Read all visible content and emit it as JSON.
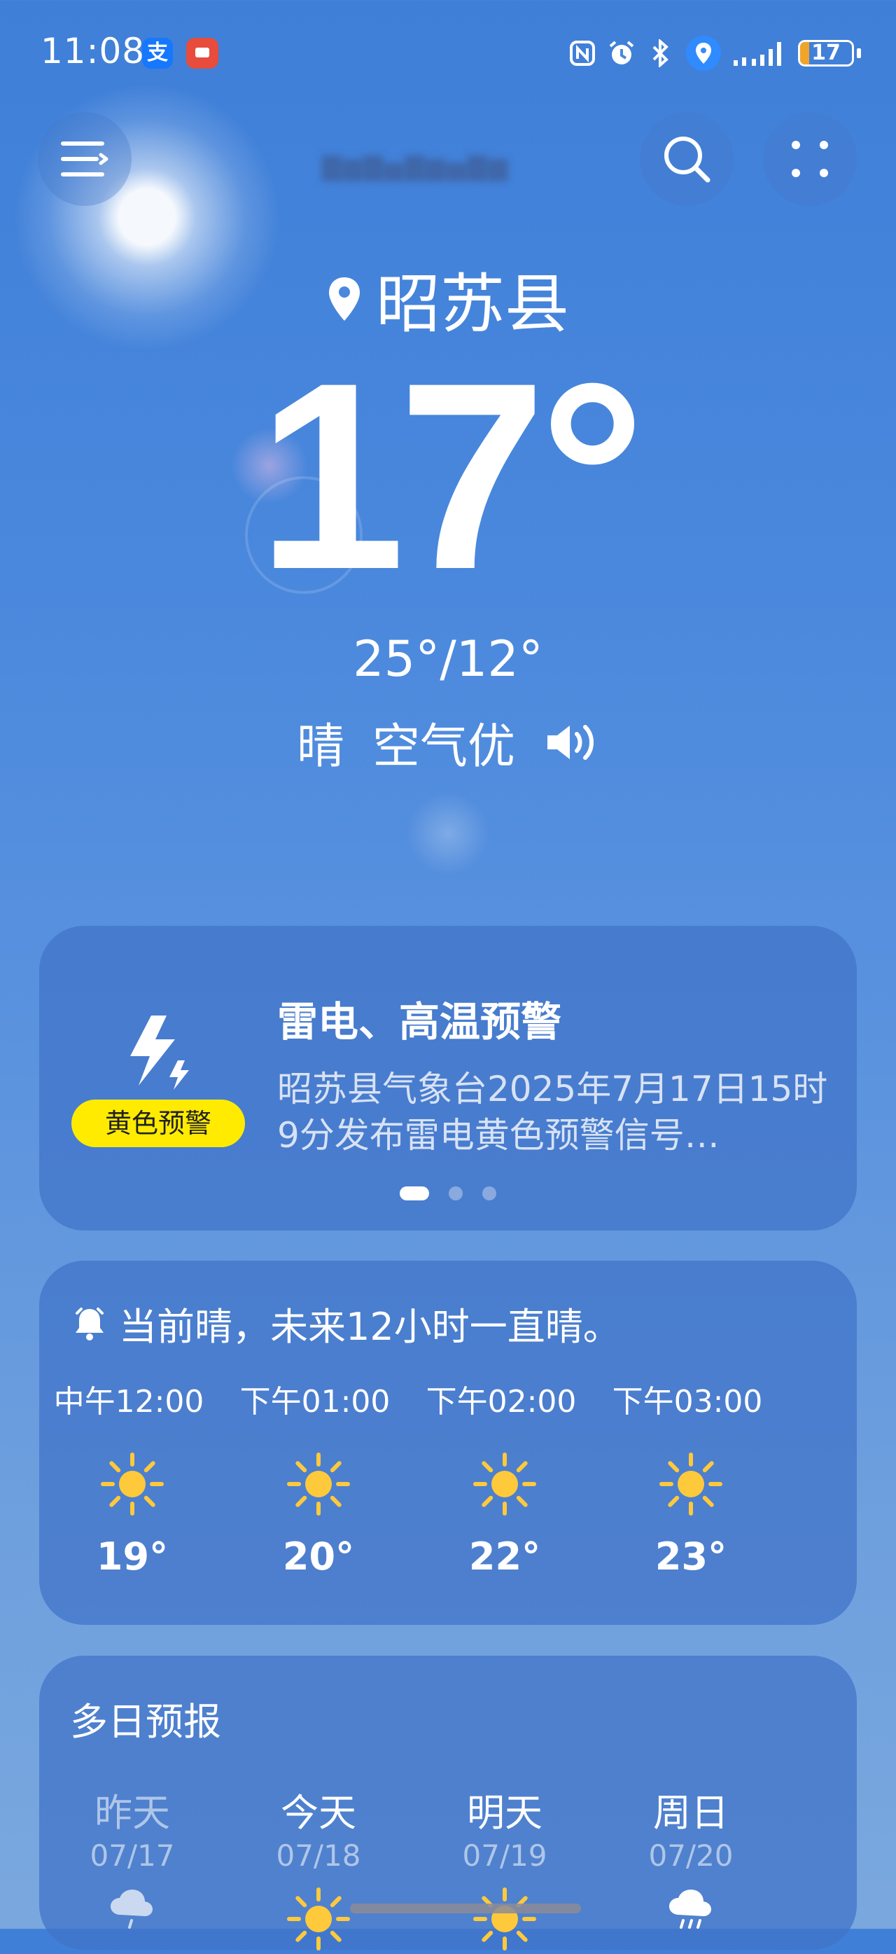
{
  "status_bar": {
    "time": "11:08",
    "alipay_glyph": "支",
    "battery": "17",
    "battery_level": 0.17,
    "icons": [
      "alipay-icon",
      "screen-recorder-icon",
      "nfc-icon",
      "alarm-icon",
      "bluetooth-icon",
      "location-icon",
      "signal-icon",
      "battery-icon"
    ]
  },
  "header": {
    "menu_icon": "menu-icon",
    "search_icon": "search-icon",
    "more_icon": "grid-dots-icon"
  },
  "location": {
    "name": "昭苏县",
    "icon": "location-pin-icon"
  },
  "current": {
    "temperature": "17°",
    "range": "25°/12°",
    "condition": "晴",
    "air_quality": "空气优",
    "speaker_icon": "speaker-icon"
  },
  "warning": {
    "title": "雷电、高温预警",
    "badge": "黄色预警",
    "body": "昭苏县气象台2025年7月17日15时9分发布雷电黄色预警信号…",
    "icon": "lightning-icon",
    "badge_color": "#ffeb00",
    "page_count": 3,
    "active_page": 1
  },
  "hourly": {
    "summary": "当前晴，未来12小时一直晴。",
    "summary_icon": "bell-icon",
    "hours": [
      {
        "time": "中午12:00",
        "icon": "sun-icon",
        "temp": "19°"
      },
      {
        "time": "下午01:00",
        "icon": "sun-icon",
        "temp": "20°"
      },
      {
        "time": "下午02:00",
        "icon": "sun-icon",
        "temp": "22°"
      },
      {
        "time": "下午03:00",
        "icon": "sun-icon",
        "temp": "23°"
      }
    ]
  },
  "daily": {
    "title": "多日预报",
    "days": [
      {
        "name": "昨天",
        "date": "07/17",
        "icon": "cloud-rain-icon"
      },
      {
        "name": "今天",
        "date": "07/18",
        "icon": "sun-icon"
      },
      {
        "name": "明天",
        "date": "07/19",
        "icon": "sun-icon"
      },
      {
        "name": "周日",
        "date": "07/20",
        "icon": "cloud-rain-icon"
      }
    ]
  },
  "colors": {
    "sun": "#ffc93c",
    "warning_badge": "#ffeb00",
    "battery": "#f0a52a"
  }
}
